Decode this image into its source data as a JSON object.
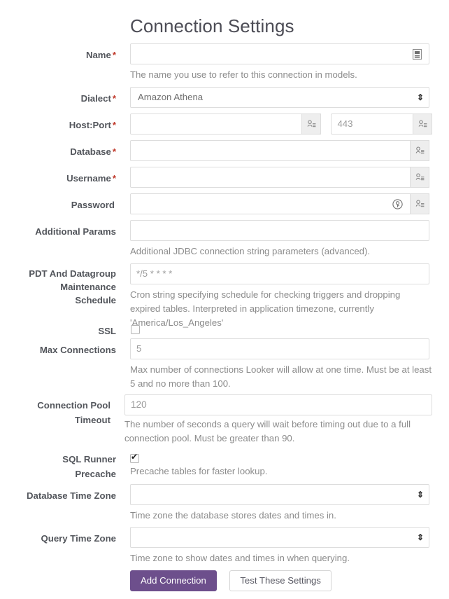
{
  "page": {
    "title": "Connection Settings"
  },
  "fields": {
    "name": {
      "label": "Name",
      "required": "*",
      "value": "",
      "placeholder": "",
      "help": "The name you use to refer to this connection in models.",
      "icon": "id-card-icon"
    },
    "dialect": {
      "label": "Dialect",
      "required": "*",
      "value": "Amazon Athena",
      "icon": "updown-arrow-icon",
      "arrow": "⇕"
    },
    "hostport": {
      "label": "Host:Port",
      "required": "*",
      "host_value": "",
      "host_placeholder": "",
      "port_value": "",
      "port_placeholder": "443",
      "addon_icon": "user-list-icon"
    },
    "database": {
      "label": "Database",
      "required": "*",
      "value": "",
      "placeholder": "",
      "addon_icon": "user-list-icon"
    },
    "username": {
      "label": "Username",
      "required": "*",
      "value": "",
      "placeholder": "",
      "addon_icon": "user-list-icon"
    },
    "password": {
      "label": "Password",
      "required": "",
      "value": "",
      "placeholder": "",
      "inline_icon": "key-circle-icon",
      "addon_icon": "user-list-icon"
    },
    "additional_params": {
      "label": "Additional Params",
      "value": "",
      "placeholder": "",
      "help": "Additional JDBC connection string parameters (advanced)."
    },
    "pdt_schedule": {
      "label_line1": "PDT And Datagroup",
      "label_line2": "Maintenance",
      "label_line3": "Schedule",
      "value": "",
      "placeholder": "*/5 * * * *",
      "help": "Cron string specifying schedule for checking triggers and dropping expired tables. Interpreted in application timezone, currently 'America/Los_Angeles'"
    },
    "ssl": {
      "label": "SSL",
      "checked": false
    },
    "max_connections": {
      "label": "Max Connections",
      "value": "",
      "placeholder": "5",
      "help": "Max number of connections Looker will allow at one time. Must be at least 5 and no more than 100."
    },
    "connection_pool_timeout": {
      "label_line1": "Connection Pool",
      "label_line2": "Timeout",
      "value": "",
      "placeholder": "120",
      "help": "The number of seconds a query will wait before timing out due to a full connection pool. Must be greater than 90."
    },
    "sql_runner_precache": {
      "label_line1": "SQL Runner",
      "label_line2": "Precache",
      "checked": true,
      "help": "Precache tables for faster lookup."
    },
    "database_time_zone": {
      "label": "Database Time Zone",
      "value": "",
      "arrow": "⇕",
      "help": "Time zone the database stores dates and times in."
    },
    "query_time_zone": {
      "label": "Query Time Zone",
      "value": "",
      "arrow": "⇕",
      "help": "Time zone to show dates and times in when querying."
    }
  },
  "actions": {
    "submit_label": "Add Connection",
    "test_label": "Test These Settings"
  },
  "colors": {
    "primary": "#6d4f8c",
    "required_asterisk": "#c0392b",
    "label_text": "#53565c",
    "help_text": "#8b8b8b",
    "input_border": "#dddddd",
    "addon_background": "#eeeeee"
  }
}
